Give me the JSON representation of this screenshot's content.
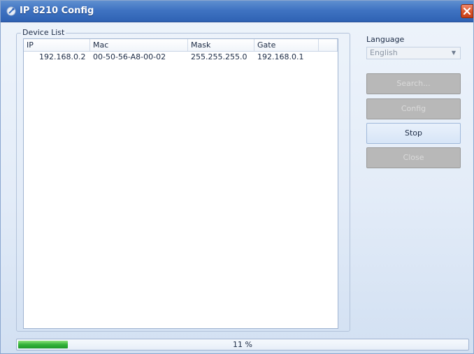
{
  "window": {
    "title": "IP 8210 Config",
    "close_icon": "close-icon"
  },
  "device_list": {
    "label": "Device List",
    "columns": [
      "IP",
      "Mac",
      "Mask",
      "Gate"
    ],
    "rows": [
      {
        "ip": "192.168.0.2",
        "mac": "00-50-56-A8-00-02",
        "mask": "255.255.255.0",
        "gate": "192.168.0.1"
      }
    ]
  },
  "language": {
    "label": "Language",
    "selected": "English"
  },
  "buttons": {
    "search": "Search...",
    "config": "Config",
    "stop": "Stop",
    "close": "Close"
  },
  "progress": {
    "value_percent": 11,
    "text": "11 %"
  },
  "colors": {
    "titlebar": "#3f73c2",
    "progress_fill": "#33b23a",
    "close_button": "#d9542a"
  }
}
